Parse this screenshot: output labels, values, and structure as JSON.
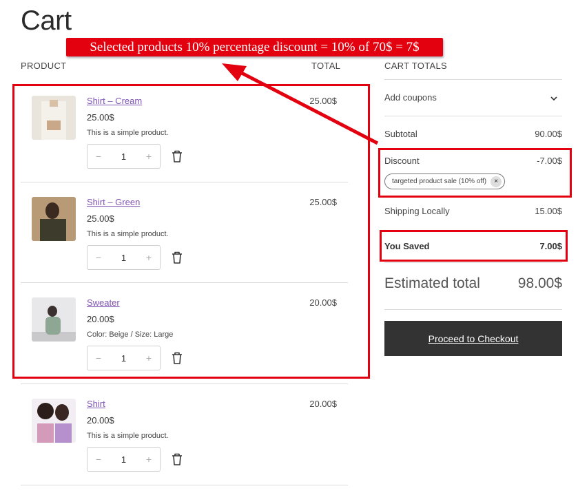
{
  "page": {
    "title": "Cart"
  },
  "columns": {
    "product": "PRODUCT",
    "total": "TOTAL"
  },
  "items": [
    {
      "name": "Shirt – Cream",
      "price": "25.00$",
      "desc": "This is a simple product.",
      "qty": "1",
      "total": "25.00$",
      "thumb_colors": [
        "#e9e4dc",
        "#cfc6b9"
      ]
    },
    {
      "name": "Shirt – Green",
      "price": "25.00$",
      "desc": "This is a simple product.",
      "qty": "1",
      "total": "25.00$",
      "thumb_colors": [
        "#b99a76",
        "#3c3b2c"
      ]
    },
    {
      "name": "Sweater",
      "price": "20.00$",
      "desc": "Color: Beige / Size: Large",
      "qty": "1",
      "total": "20.00$",
      "thumb_colors": [
        "#e8e8ea",
        "#8ea694"
      ]
    },
    {
      "name": "Shirt",
      "price": "20.00$",
      "desc": "This is a simple product.",
      "qty": "1",
      "total": "20.00$",
      "thumb_colors": [
        "#f2eef3",
        "#b690cc"
      ]
    }
  ],
  "qty_controls": {
    "minus": "−",
    "plus": "+"
  },
  "totals": {
    "heading": "CART TOTALS",
    "coupons_label": "Add coupons",
    "subtotal_label": "Subtotal",
    "subtotal_value": "90.00$",
    "discount_label": "Discount",
    "discount_value": "-7.00$",
    "coupon_chip": "targeted product sale (10% off)",
    "coupon_remove": "×",
    "shipping_label": "Shipping Locally",
    "shipping_value": "15.00$",
    "saved_label": "You Saved",
    "saved_value": "7.00$",
    "estimated_label": "Estimated total",
    "estimated_value": "98.00$",
    "checkout_label": "Proceed to Checkout"
  },
  "annotation": {
    "banner_text": "Selected products 10% percentage discount = 10% of 70$ = 7$",
    "color": "#e3000f"
  }
}
